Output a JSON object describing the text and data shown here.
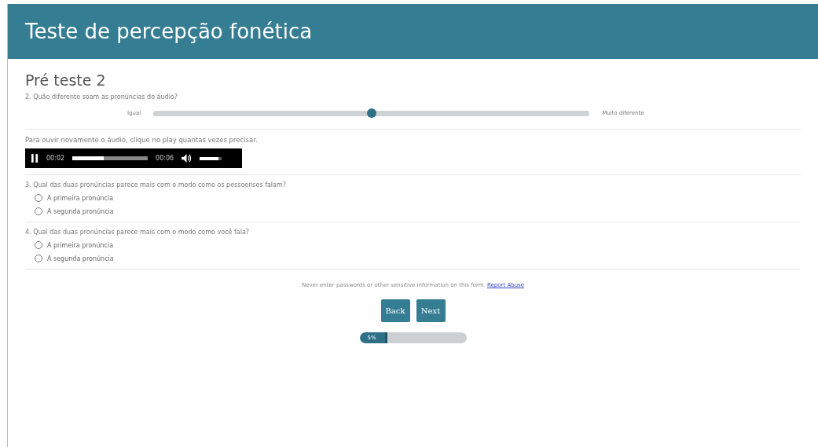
{
  "header": {
    "title": "Teste de percepção fonética"
  },
  "page_title": "Pré teste 2",
  "scale_question": {
    "text": "2. Quão diferente soam as pronúncias do áudio?",
    "min_label": "Igual",
    "max_label": "Muito diferente",
    "level": 0.5
  },
  "audio_hint": "Para ouvir novamente o áudio, clique no play quantas vezes precisar.",
  "audio": {
    "playing": true,
    "current": "00:02",
    "duration": "00:06",
    "level": 0.42,
    "volume": {
      "level": 0.85
    }
  },
  "questions": [
    {
      "text": "3. Qual das duas pronúncias parece mais com o modo como os pessoenses falam?",
      "options": [
        {
          "label": "A primeira pronúncia",
          "selected": false
        },
        {
          "label": "A segunda pronúncia",
          "selected": false
        }
      ]
    },
    {
      "text": "4. Qual das duas pronúncias parece mais com o modo como você fala?",
      "options": [
        {
          "label": "A primeira pronúncia",
          "selected": false
        },
        {
          "label": "A segunda pronúncia",
          "selected": false
        }
      ]
    }
  ],
  "notice": {
    "text": "Never enter passwords or other sensitive information on this form.",
    "link": "Report Abuse"
  },
  "buttons": [
    "Back",
    "Next"
  ],
  "progress": {
    "label": "5%",
    "level": 0.26
  }
}
